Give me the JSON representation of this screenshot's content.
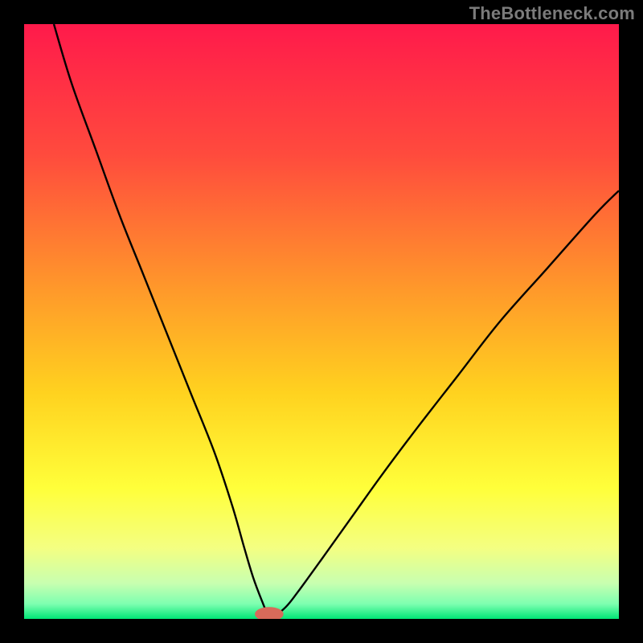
{
  "watermark": "TheBottleneck.com",
  "chart_data": {
    "type": "line",
    "title": "",
    "xlabel": "",
    "ylabel": "",
    "xlim": [
      0,
      100
    ],
    "ylim": [
      0,
      100
    ],
    "grid": false,
    "legend": false,
    "gradient_stops": [
      {
        "offset": 0.0,
        "color": "#ff1a4b"
      },
      {
        "offset": 0.22,
        "color": "#ff4b3d"
      },
      {
        "offset": 0.45,
        "color": "#ff9a2a"
      },
      {
        "offset": 0.62,
        "color": "#ffd21f"
      },
      {
        "offset": 0.78,
        "color": "#ffff3a"
      },
      {
        "offset": 0.88,
        "color": "#f4ff81"
      },
      {
        "offset": 0.94,
        "color": "#c8ffb0"
      },
      {
        "offset": 0.975,
        "color": "#7dffb0"
      },
      {
        "offset": 1.0,
        "color": "#00e676"
      }
    ],
    "series": [
      {
        "name": "bottleneck-curve",
        "stroke": "#000000",
        "stroke_width": 2.4,
        "x": [
          5,
          8,
          12,
          16,
          20,
          24,
          28,
          32,
          35,
          37,
          38.5,
          40,
          41,
          42,
          44,
          46,
          50,
          55,
          60,
          66,
          73,
          80,
          88,
          96,
          100
        ],
        "y": [
          100,
          90,
          79,
          68,
          58,
          48,
          38,
          28,
          19,
          12,
          7,
          3,
          0.8,
          0.5,
          2,
          4.5,
          10,
          17,
          24,
          32,
          41,
          50,
          59,
          68,
          72
        ]
      }
    ],
    "marker": {
      "name": "min-marker",
      "x": 41.2,
      "y": 0.8,
      "rx": 2.4,
      "ry": 1.2,
      "fill": "#d86a5a"
    }
  }
}
